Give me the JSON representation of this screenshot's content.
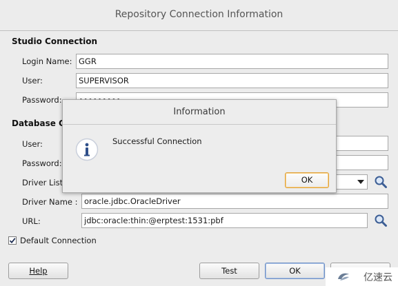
{
  "dialog": {
    "title": "Repository Connection Information"
  },
  "studio": {
    "heading": "Studio Connection",
    "login_label": "Login Name:",
    "login_value": "GGR",
    "user_label": "User:",
    "user_value": "SUPERVISOR",
    "password_label": "Password:",
    "password_value": "•••••••••"
  },
  "database": {
    "heading": "Database Connection",
    "user_label": "User:",
    "password_label": "Password:",
    "driver_list_label": "Driver List:",
    "driver_name_label": "Driver Name :",
    "driver_name_value": "oracle.jdbc.OracleDriver",
    "url_label": "URL:",
    "url_value": "jdbc:oracle:thin:@erptest:1531:pbf"
  },
  "default_connection": {
    "label": "Default Connection",
    "checked": true
  },
  "buttons": {
    "help": "Help",
    "test": "Test",
    "ok": "OK",
    "cancel": "Cancel"
  },
  "modal": {
    "title": "Information",
    "message": "Successful Connection",
    "ok": "OK"
  },
  "watermark": {
    "text": "亿速云"
  },
  "colors": {
    "info_icon": "#2f4f8a",
    "focus_ok_border": "#e0a23b"
  }
}
